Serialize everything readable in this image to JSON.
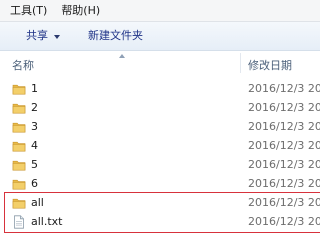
{
  "menu": {
    "tools": "工具(T)",
    "help": "帮助(H)"
  },
  "toolbar": {
    "share_label": "共享",
    "new_folder_label": "新建文件夹"
  },
  "columns": {
    "name": "名称",
    "date_modified": "修改日期"
  },
  "files": [
    {
      "name": "1",
      "date": "2016/12/3 20:",
      "type": "folder"
    },
    {
      "name": "2",
      "date": "2016/12/3 20:",
      "type": "folder"
    },
    {
      "name": "3",
      "date": "2016/12/3 20:",
      "type": "folder"
    },
    {
      "name": "4",
      "date": "2016/12/3 20:",
      "type": "folder"
    },
    {
      "name": "5",
      "date": "2016/12/3 20:",
      "type": "folder"
    },
    {
      "name": "6",
      "date": "2016/12/3 20:",
      "type": "folder"
    },
    {
      "name": "all",
      "date": "2016/12/3 20:",
      "type": "folder"
    },
    {
      "name": "all.txt",
      "date": "2016/12/3 20:",
      "type": "text-file"
    }
  ],
  "colors": {
    "folder": "#e8b948",
    "highlight": "#d7323c",
    "toolbar_text": "#1e3287"
  }
}
